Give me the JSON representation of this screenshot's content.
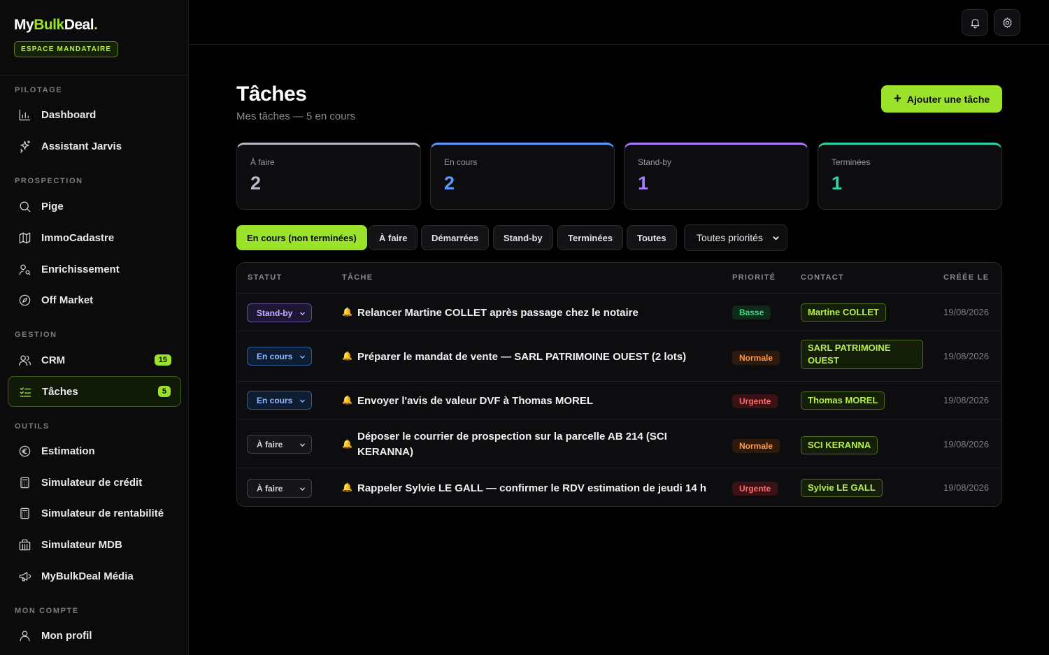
{
  "brand": {
    "logo_a": "My",
    "logo_b": "Bulk",
    "logo_c": "Deal",
    "logo_dot": ".",
    "space": "ESPACE MANDATAIRE"
  },
  "nav": {
    "sections": {
      "pilotage": "PILOTAGE",
      "prospection": "PROSPECTION",
      "gestion": "GESTION",
      "outils": "OUTILS",
      "compte": "MON COMPTE"
    },
    "items": {
      "dashboard": "Dashboard",
      "jarvis": "Assistant Jarvis",
      "pige": "Pige",
      "immocadastre": "ImmoCadastre",
      "enrichissement": "Enrichissement",
      "offmarket": "Off Market",
      "crm": "CRM",
      "taches": "Tâches",
      "estimation": "Estimation",
      "credit": "Simulateur de crédit",
      "rentabilite": "Simulateur de rentabilité",
      "mdb": "Simulateur MDB",
      "media": "MyBulkDeal Média",
      "profil": "Mon profil"
    },
    "counts": {
      "crm": "15",
      "taches": "5"
    }
  },
  "header": {
    "title": "Tâches",
    "subtitle": "Mes tâches — 5 en cours",
    "add_label": "Ajouter une tâche"
  },
  "stats": [
    {
      "label": "À faire",
      "value": "2",
      "color": "#b8bac6"
    },
    {
      "label": "En cours",
      "value": "2",
      "color": "#5b9bff"
    },
    {
      "label": "Stand-by",
      "value": "1",
      "color": "#a87bff"
    },
    {
      "label": "Terminées",
      "value": "1",
      "color": "#2dd4a4"
    }
  ],
  "filters": {
    "encours": "En cours (non terminées)",
    "afaire": "À faire",
    "demarrees": "Démarrées",
    "standby": "Stand-by",
    "terminees": "Terminées",
    "toutes": "Toutes",
    "priorites": "Toutes priorités"
  },
  "table": {
    "headers": {
      "statut": "STATUT",
      "tache": "TÂCHE",
      "priorite": "PRIORITÉ",
      "contact": "CONTACT",
      "creee": "CRÉÉE LE"
    },
    "rows": [
      {
        "status": "Stand-by",
        "task": "Relancer Martine COLLET après passage chez le notaire",
        "priority": "Basse",
        "contact": "Martine COLLET",
        "date": "19/08/2026"
      },
      {
        "status": "En cours",
        "task": "Préparer le mandat de vente — SARL PATRIMOINE OUEST (2 lots)",
        "priority": "Normale",
        "contact": "SARL PATRIMOINE OUEST",
        "date": "19/08/2026"
      },
      {
        "status": "En cours",
        "task": "Envoyer l'avis de valeur DVF à Thomas MOREL",
        "priority": "Urgente",
        "contact": "Thomas MOREL",
        "date": "19/08/2026"
      },
      {
        "status": "À faire",
        "task": "Déposer le courrier de prospection sur la parcelle AB 214 (SCI KERANNA)",
        "priority": "Normale",
        "contact": "SCI KERANNA",
        "date": "19/08/2026"
      },
      {
        "status": "À faire",
        "task": "Rappeler Sylvie LE GALL — confirmer le RDV estimation de jeudi 14 h",
        "priority": "Urgente",
        "contact": "Sylvie LE GALL",
        "date": "19/08/2026"
      }
    ]
  },
  "icons": {
    "dashboard": "bar-chart-icon",
    "jarvis": "sparkles-icon",
    "pige": "search-icon",
    "immocadastre": "map-icon",
    "enrichissement": "user-search-icon",
    "offmarket": "compass-icon",
    "crm": "users-icon",
    "taches": "checklist-icon",
    "estimation": "euro-circle-icon",
    "credit": "calculator-icon",
    "rentabilite": "calculator-icon",
    "mdb": "building-icon",
    "media": "megaphone-icon",
    "profil": "user-icon",
    "bell": "bell-icon",
    "settings": "gear-icon"
  },
  "colors": {
    "accent": "#9be22b",
    "background": "#000000",
    "surface": "#0d0d0f"
  }
}
